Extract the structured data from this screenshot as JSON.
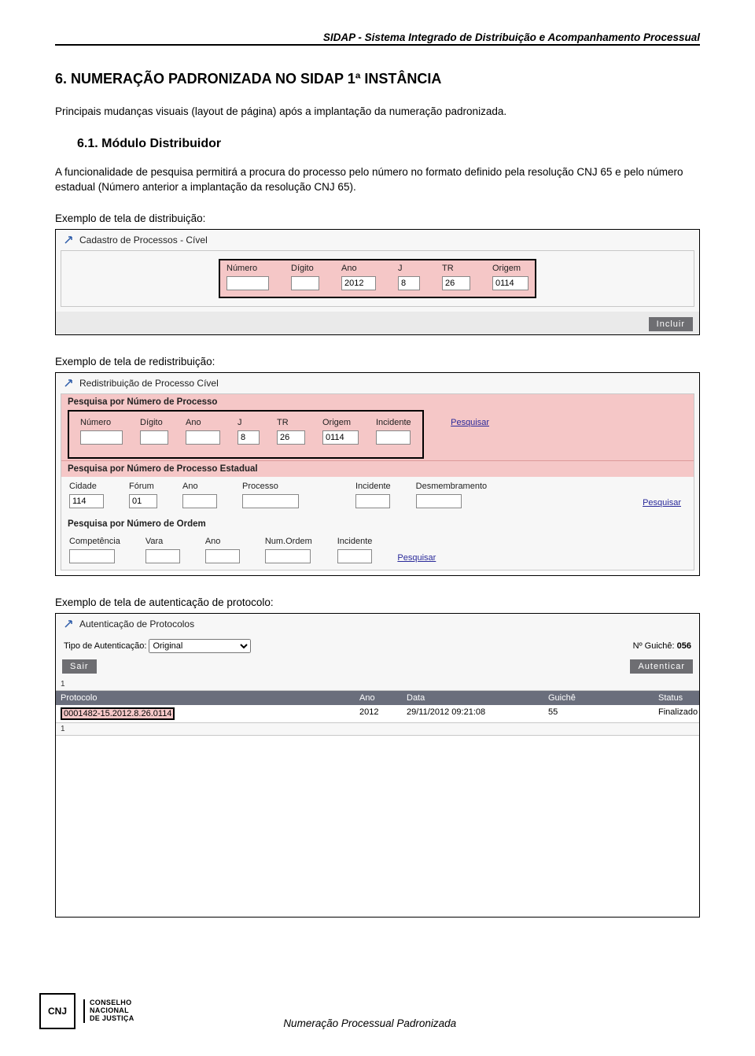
{
  "header": "SIDAP - Sistema Integrado de Distribuição e Acompanhamento Processual",
  "section": {
    "title": "6. NUMERAÇÃO PADRONIZADA NO SIDAP 1ª INSTÂNCIA",
    "intro": "Principais mudanças visuais (layout de página) após a implantação da numeração padronizada.",
    "sub_title": "6.1. Módulo Distribuidor",
    "sub_text": "A funcionalidade de pesquisa permitirá a procura do processo pelo número no formato definido pela resolução CNJ 65 e pelo número estadual (Número anterior a implantação da resolução CNJ 65).",
    "caption1": "Exemplo de tela de distribuição:",
    "caption2": "Exemplo de tela de redistribuição:",
    "caption3": "Exemplo de tela de autenticação de protocolo:"
  },
  "panel1": {
    "title": "Cadastro de Processos - Cível",
    "labels": {
      "numero": "Número",
      "digito": "Dígito",
      "ano": "Ano",
      "j": "J",
      "tr": "TR",
      "origem": "Origem"
    },
    "values": {
      "numero": "",
      "digito": "",
      "ano": "2012",
      "j": "8",
      "tr": "26",
      "origem": "0114"
    },
    "btn_incluir": "Incluir"
  },
  "panel2": {
    "title": "Redistribuição de Processo Cível",
    "h1": "Pesquisa por Número de Processo",
    "labels1": {
      "numero": "Número",
      "digito": "Dígito",
      "ano": "Ano",
      "j": "J",
      "tr": "TR",
      "origem": "Origem",
      "incidente": "Incidente"
    },
    "values1": {
      "numero": "",
      "digito": "",
      "ano": "",
      "j": "8",
      "tr": "26",
      "origem": "0114",
      "incidente": ""
    },
    "pesq": "Pesquisar",
    "h2": "Pesquisa por Número de Processo Estadual",
    "labels2": {
      "cidade": "Cidade",
      "forum": "Fórum",
      "ano": "Ano",
      "processo": "Processo",
      "incidente": "Incidente",
      "desmem": "Desmembramento"
    },
    "values2": {
      "cidade": "114",
      "forum": "01",
      "ano": "",
      "processo": "",
      "incidente": "",
      "desmem": ""
    },
    "h3": "Pesquisa por Número de Ordem",
    "labels3": {
      "comp": "Competência",
      "vara": "Vara",
      "ano": "Ano",
      "numordem": "Num.Ordem",
      "incidente": "Incidente"
    }
  },
  "panel3": {
    "title": "Autenticação de Protocolos",
    "tipo_label": "Tipo de Autenticação:",
    "tipo_value": "Original",
    "guiche_label": "Nº Guichê:",
    "guiche_value": "056",
    "btn_sair": "Sair",
    "btn_autenticar": "Autenticar",
    "corner": "1",
    "cols": {
      "proto": "Protocolo",
      "ano": "Ano",
      "data": "Data",
      "guiche": "Guichê",
      "status": "Status"
    },
    "row": {
      "proto": "0001482-15.2012.8.26.0114",
      "ano": "2012",
      "data": "29/11/2012 09:21:08",
      "guiche": "55",
      "status": "Finalizado"
    },
    "corner2": "1"
  },
  "footer": {
    "logo_initials": "CNJ",
    "logo_l1": "CONSELHO",
    "logo_l2": "NACIONAL",
    "logo_l3": "DE JUSTIÇA",
    "text": "Numeração Processual Padronizada"
  }
}
